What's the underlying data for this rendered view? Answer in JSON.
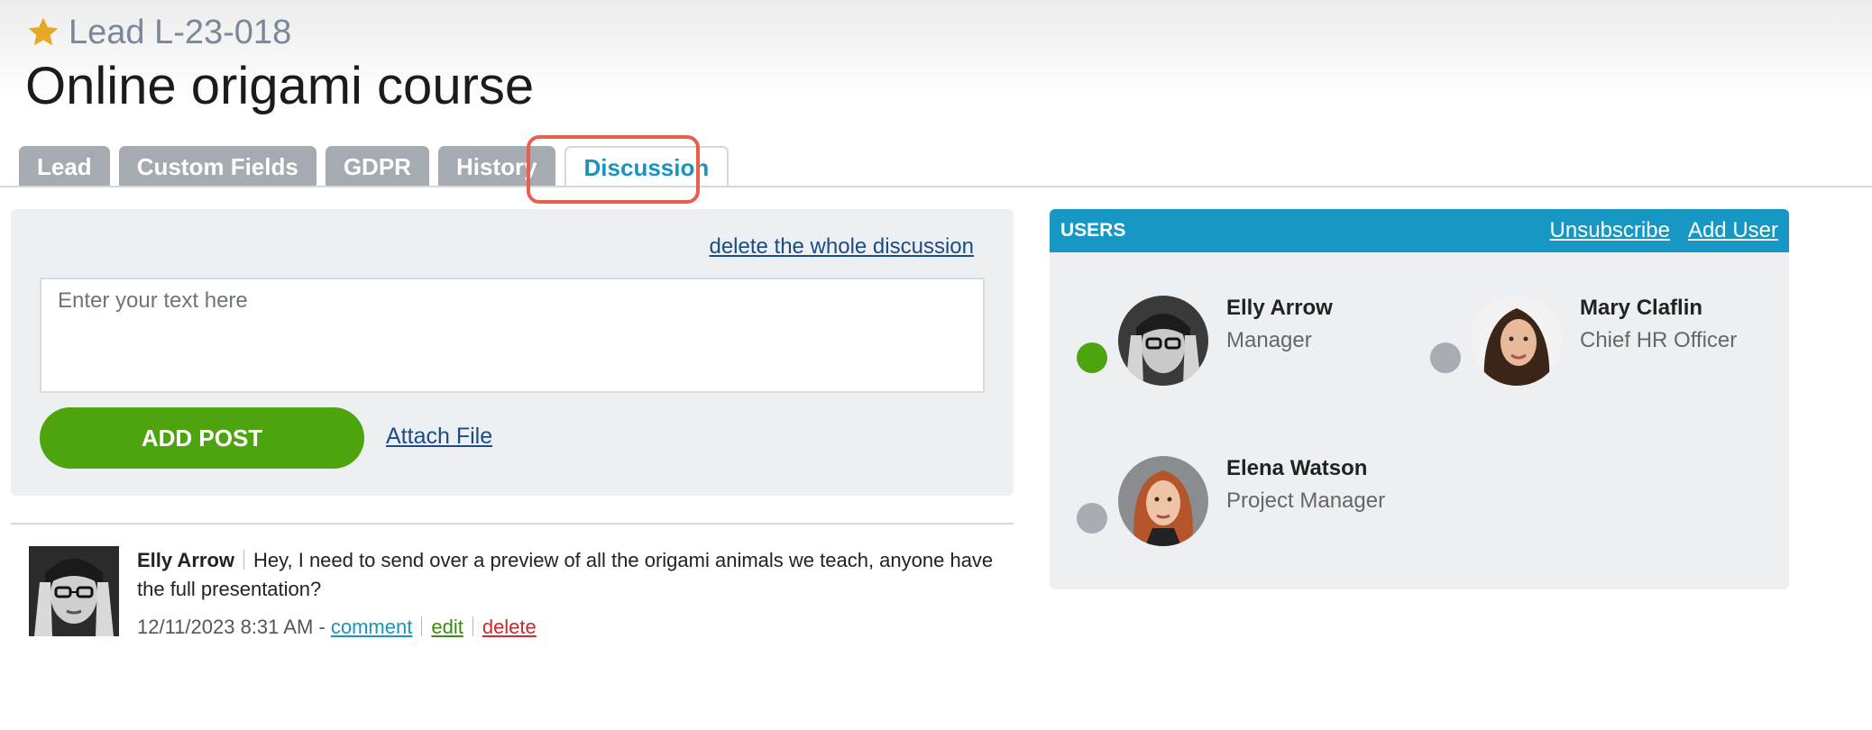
{
  "header": {
    "lead_label": "Lead L-23-018",
    "title": "Online origami course"
  },
  "tabs": [
    {
      "label": "Lead",
      "active": false
    },
    {
      "label": "Custom Fields",
      "active": false
    },
    {
      "label": "GDPR",
      "active": false
    },
    {
      "label": "History",
      "active": false
    },
    {
      "label": "Discussion",
      "active": true
    }
  ],
  "discussion": {
    "delete_whole_label": "delete the whole discussion",
    "input_placeholder": "Enter your text here",
    "input_value": "",
    "add_post_label": "ADD POST",
    "attach_file_label": "Attach File"
  },
  "posts": [
    {
      "author": "Elly Arrow",
      "text": "Hey, I need to send over a preview of all the origami animals we teach, anyone have the full presentation?",
      "timestamp": "12/11/2023 8:31 AM - ",
      "comment_label": "comment",
      "edit_label": "edit",
      "delete_label": "delete"
    }
  ],
  "users_panel": {
    "title": "USERS",
    "unsubscribe_label": "Unsubscribe",
    "add_user_label": "Add User",
    "users": [
      {
        "name": "Elly Arrow",
        "role": "Manager",
        "status": "online"
      },
      {
        "name": "Mary Claflin",
        "role": "Chief HR Officer",
        "status": "offline"
      },
      {
        "name": "Elena Watson",
        "role": "Project Manager",
        "status": "offline"
      }
    ]
  },
  "colors": {
    "accent": "#1798c4",
    "add_post": "#4ea40f",
    "online": "#4ea40f",
    "offline": "#a9adb3",
    "highlight": "#e8604c",
    "star": "#e6a923"
  },
  "icons": {
    "favorite": "star-icon",
    "avatar": "user-photo"
  }
}
